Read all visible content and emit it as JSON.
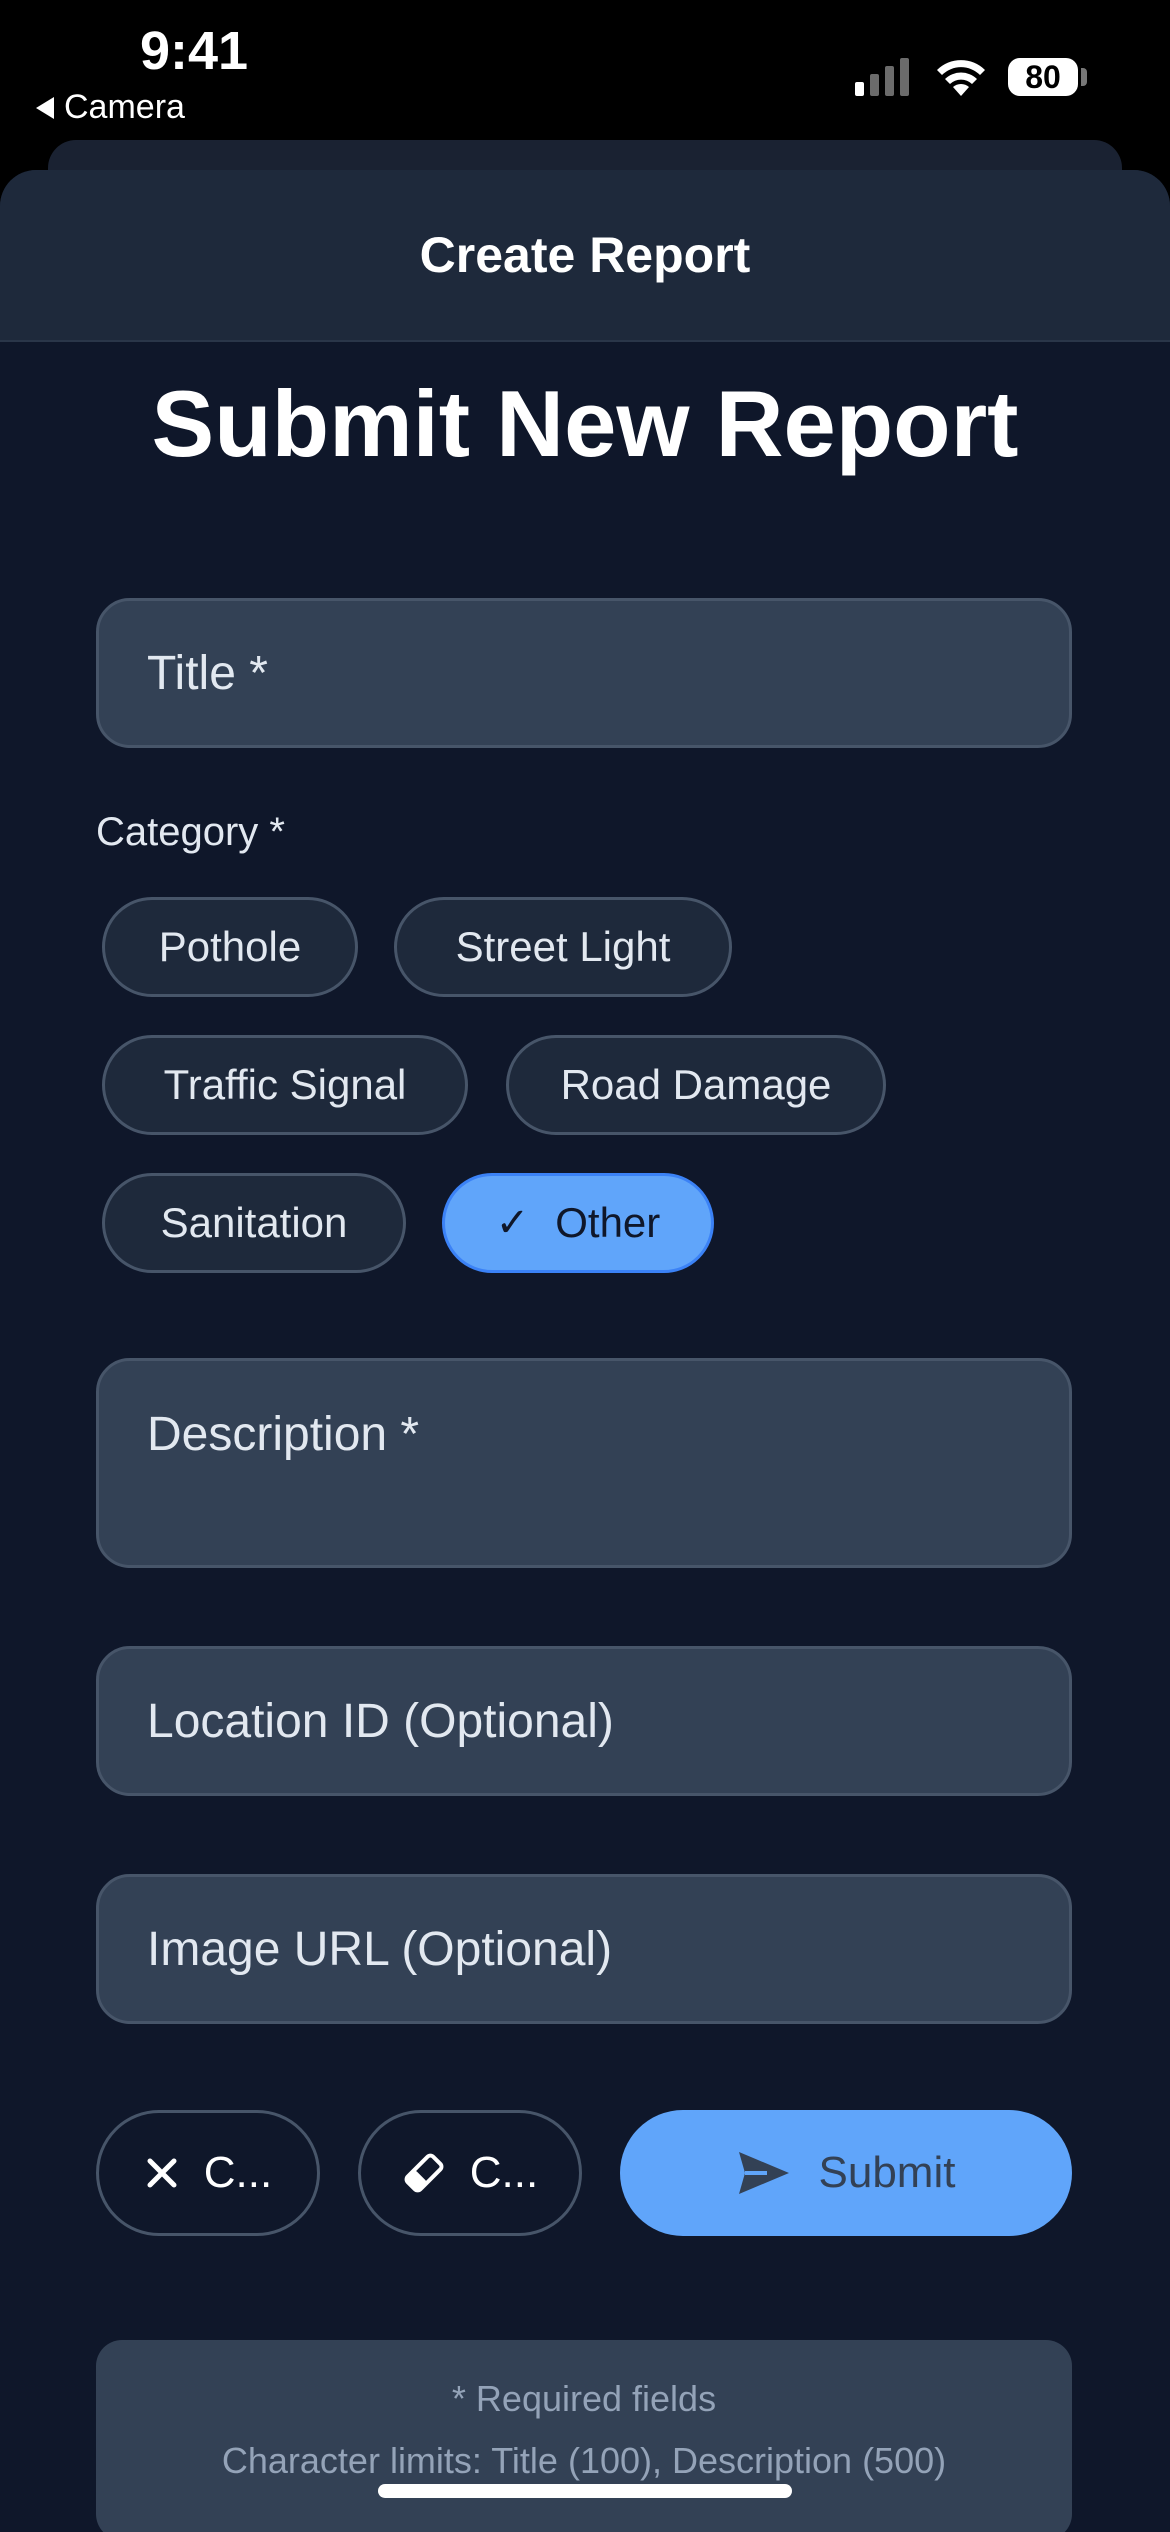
{
  "status": {
    "time": "9:41",
    "back_app": "Camera",
    "battery": "80"
  },
  "sheet": {
    "title": "Create Report"
  },
  "form": {
    "heading": "Submit New Report",
    "title_placeholder": "Title *",
    "category_label": "Category *",
    "categories": [
      {
        "label": "Pothole",
        "selected": false
      },
      {
        "label": "Street Light",
        "selected": false
      },
      {
        "label": "Traffic Signal",
        "selected": false
      },
      {
        "label": "Road Damage",
        "selected": false
      },
      {
        "label": "Sanitation",
        "selected": false
      },
      {
        "label": "Other",
        "selected": true
      }
    ],
    "description_placeholder": "Description *",
    "location_placeholder": "Location ID (Optional)",
    "image_placeholder": "Image URL (Optional)"
  },
  "actions": {
    "cancel_label": "C...",
    "clear_label": "C...",
    "submit_label": "Submit"
  },
  "info": {
    "required": "* Required fields",
    "limits": "Character limits: Title (100), Description (500)"
  },
  "colors": {
    "background": "#0f172a",
    "field": "#334155",
    "accent": "#60a5fa"
  }
}
